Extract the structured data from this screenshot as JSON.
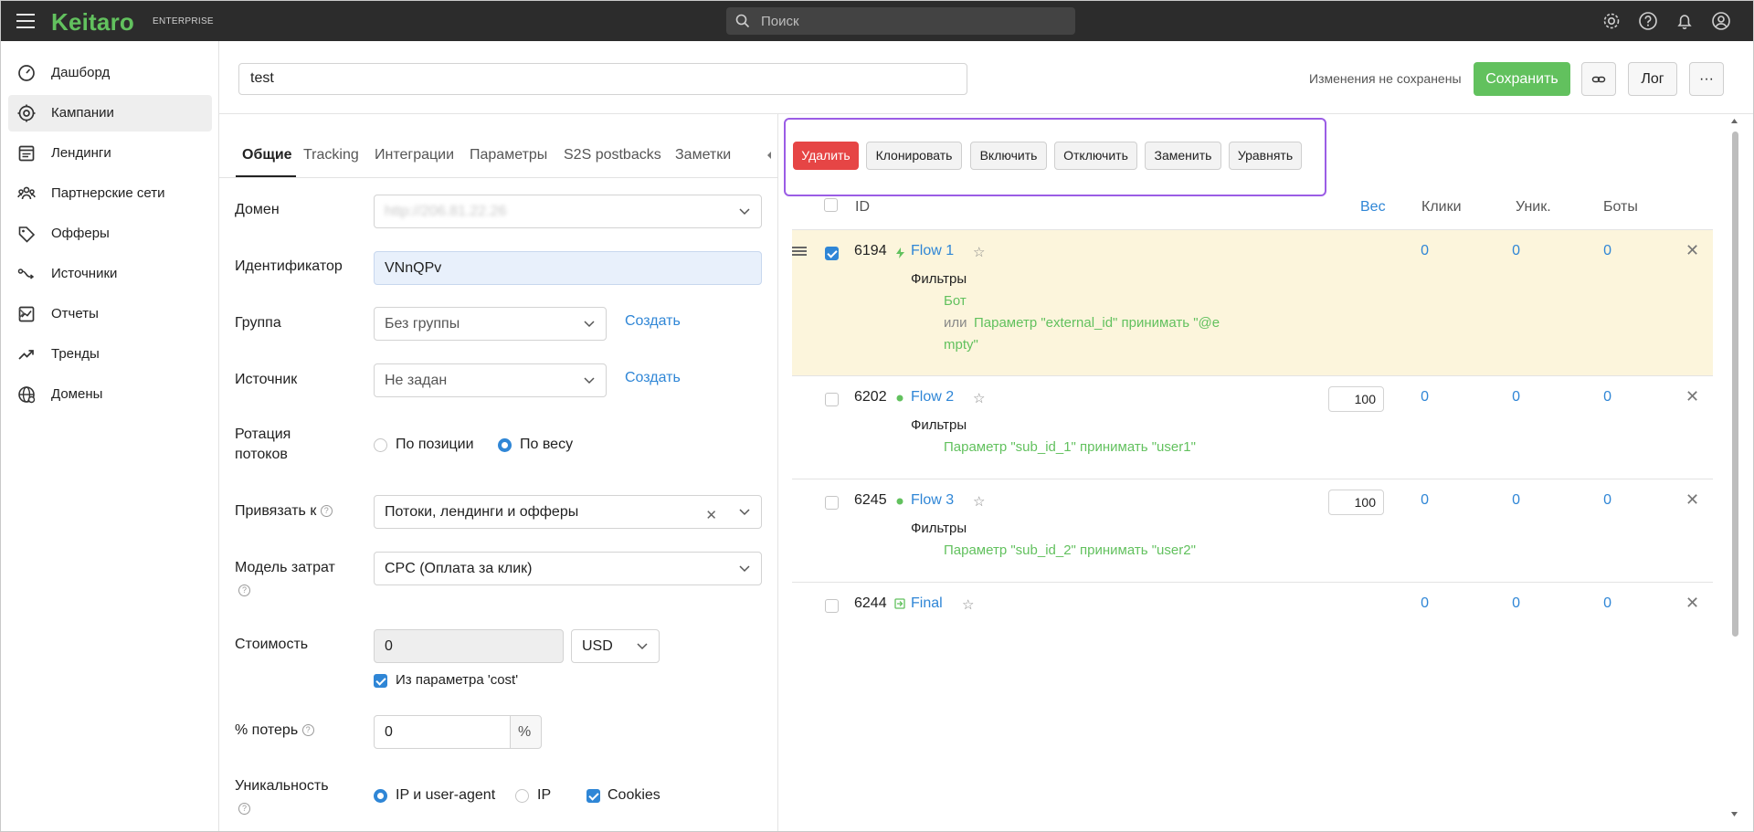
{
  "topbar": {
    "logo": "Keitaro",
    "logo_sub": "ENTERPRISE",
    "search_placeholder": "Поиск",
    "brand_color": "#62c15e",
    "icons": [
      "gear-icon",
      "help-icon",
      "bell-icon",
      "user-icon"
    ]
  },
  "sidebar": {
    "items": [
      {
        "label": "Дашборд",
        "icon": "dashboard-icon"
      },
      {
        "label": "Кампании",
        "icon": "campaigns-icon"
      },
      {
        "label": "Лендинги",
        "icon": "landings-icon"
      },
      {
        "label": "Партнерские сети",
        "icon": "partners-icon"
      },
      {
        "label": "Офферы",
        "icon": "offers-icon"
      },
      {
        "label": "Источники",
        "icon": "sources-icon"
      },
      {
        "label": "Отчеты",
        "icon": "reports-icon"
      },
      {
        "label": "Тренды",
        "icon": "trends-icon"
      },
      {
        "label": "Домены",
        "icon": "domains-icon"
      }
    ],
    "active_index": 1
  },
  "header": {
    "campaign_name": "test",
    "unsaved": "Изменения не сохранены",
    "save": "Сохранить",
    "log": "Лог",
    "more": "···"
  },
  "tabs": [
    "Общие",
    "Tracking",
    "Интеграции",
    "Параметры",
    "S2S postbacks",
    "Заметки"
  ],
  "form": {
    "domain_label": "Домен",
    "domain_value": "http://206.81.22.26",
    "identifier_label": "Идентификатор",
    "identifier_value": "VNnQPv",
    "group_label": "Группа",
    "group_value": "Без группы",
    "create": "Создать",
    "source_label": "Источник",
    "source_value": "Не задан",
    "rotation_label": "Ротация потоков",
    "rotation_opt1": "По позиции",
    "rotation_opt2": "По весу",
    "bind_label": "Привязать к",
    "bind_value": "Потоки, лендинги и офферы",
    "cost_model_label": "Модель затрат",
    "cost_model_value": "CPC (Оплата за клик)",
    "cost_label": "Стоимость",
    "cost_value": "0",
    "currency": "USD",
    "cost_param": "Из параметра 'cost'",
    "loss_label": "% потерь",
    "loss_value": "0",
    "loss_unit": "%",
    "uniq_label": "Уникальность",
    "uniq_opt1": "IP и user-agent",
    "uniq_opt2": "IP",
    "uniq_opt3": "Cookies"
  },
  "actions": [
    "Удалить",
    "Клонировать",
    "Включить",
    "Отключить",
    "Заменить",
    "Уравнять"
  ],
  "table": {
    "headers": {
      "id": "ID",
      "weight": "Вес",
      "clicks": "Клики",
      "uniq": "Уник.",
      "bots": "Боты"
    },
    "filters_label": "Фильтры",
    "rows": [
      {
        "id": "6194",
        "name": "Flow 1",
        "weight": "",
        "clicks": "0",
        "uniq": "0",
        "bots": "0",
        "filters": [
          "Бот",
          "или",
          "Параметр \"external_id\"  принимать \"@e",
          "mpty\""
        ]
      },
      {
        "id": "6202",
        "name": "Flow 2",
        "weight": "100",
        "clicks": "0",
        "uniq": "0",
        "bots": "0",
        "filters": [
          "Параметр \"sub_id_1\"  принимать \"user1\""
        ]
      },
      {
        "id": "6245",
        "name": "Flow 3",
        "weight": "100",
        "clicks": "0",
        "uniq": "0",
        "bots": "0",
        "filters": [
          "Параметр \"sub_id_2\"  принимать \"user2\""
        ]
      },
      {
        "id": "6244",
        "name": "Final",
        "weight": "",
        "clicks": "0",
        "uniq": "0",
        "bots": "0",
        "filters": []
      }
    ]
  }
}
